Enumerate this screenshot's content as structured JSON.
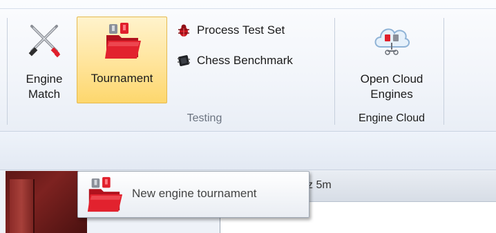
{
  "ribbon": {
    "groups": {
      "testing": {
        "label": "Testing",
        "engine_match": {
          "label_line1": "Engine",
          "label_line2": "Match",
          "icon": "crossed-swords-icon"
        },
        "tournament": {
          "label": "Tournament",
          "icon": "folder-pieces-icon",
          "state": "hovered"
        },
        "process_test_set": {
          "label": "Process Test Set",
          "icon": "bug-icon"
        },
        "chess_benchmark": {
          "label": "Chess Benchmark",
          "icon": "chip-icon"
        }
      },
      "engine_cloud": {
        "label": "Engine Cloud",
        "open_cloud_engines": {
          "label_line1": "Open Cloud",
          "label_line2": "Engines",
          "icon": "cloud-engines-icon"
        }
      }
    }
  },
  "panel": {
    "header_fragment": "z 5m"
  },
  "tooltip": {
    "text": "New engine tournament",
    "icon": "folder-pieces-icon"
  },
  "colors": {
    "hover_fill": "#fde39a",
    "hover_border": "#e5b94d",
    "board_red": "#7d2220"
  }
}
